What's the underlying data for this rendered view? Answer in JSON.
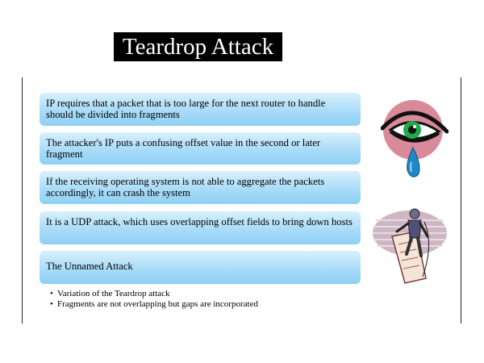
{
  "slide": {
    "title": "Teardrop Attack",
    "bullets": [
      "IP requires that a packet that is too large for the next router to handle should be divided into fragments",
      "The attacker's IP puts a confusing offset value in the second or later fragment",
      "If the receiving operating system is not able to aggregate the packets accordingly, it can crash the system",
      "It is a UDP attack, which uses overlapping offset fields to bring down hosts",
      "The Unnamed Attack"
    ],
    "sub_bullets": [
      "Variation of the Teardrop attack",
      "Fragments are not overlapping  but gaps are incorporated"
    ],
    "bullet_symbol": "•"
  },
  "colors": {
    "title_bg": "#000000",
    "title_text": "#ffffff",
    "box_light": "#d9f1fd",
    "box_dark": "#8fd0f4",
    "eye_circle": "#d98a9a",
    "iris": "#1faa48",
    "tear": "#1e88c8"
  },
  "icons": [
    "crying-eye-clipart",
    "mountain-climber-clipart"
  ]
}
